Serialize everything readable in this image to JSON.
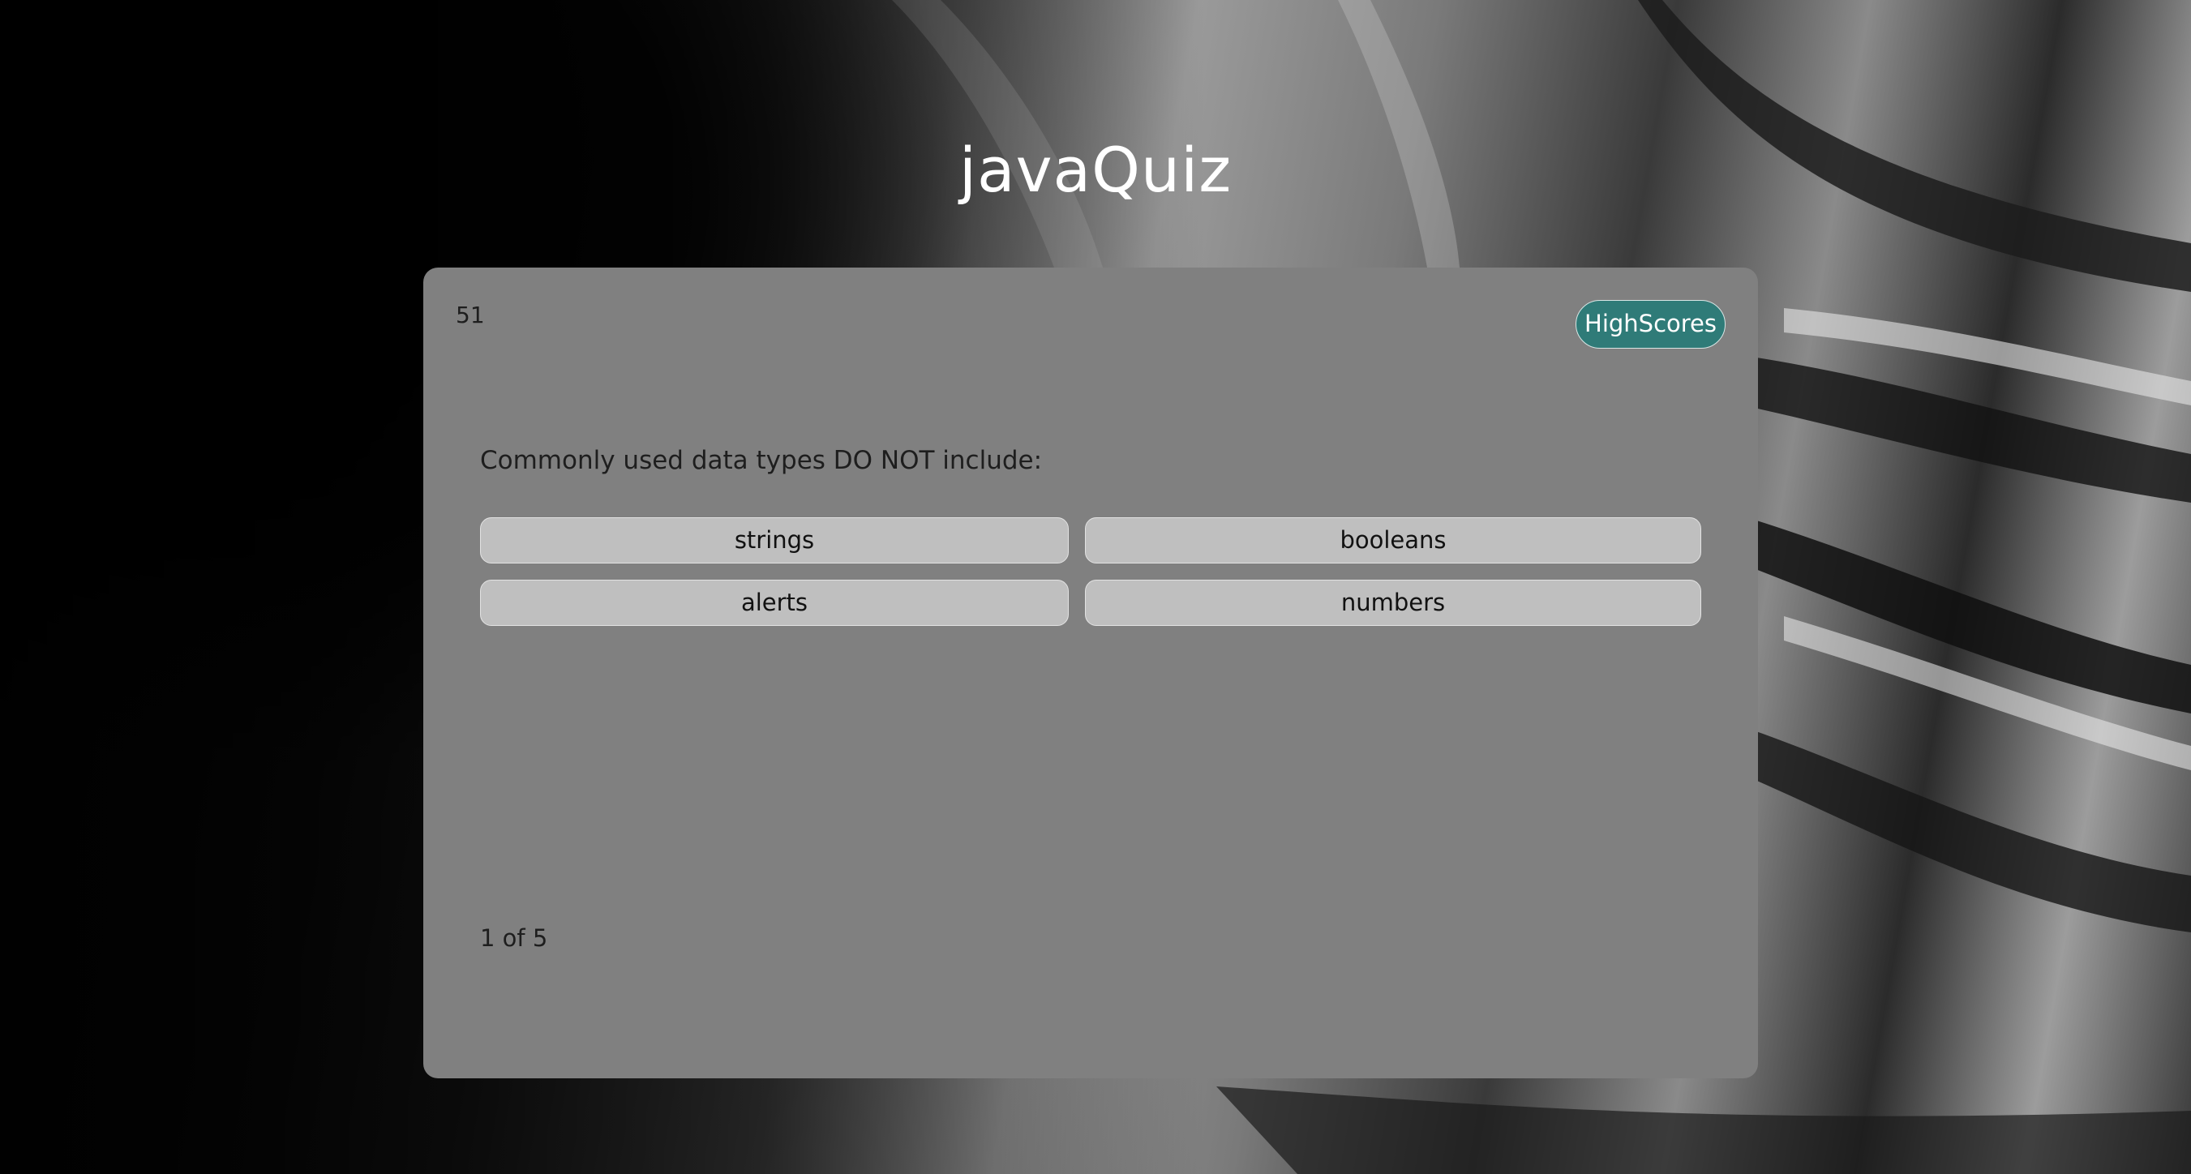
{
  "header": {
    "title": "javaQuiz"
  },
  "quiz": {
    "timer": "51",
    "highscores_label": "HighScores",
    "question": "Commonly used data types DO NOT include:",
    "answers": [
      "strings",
      "booleans",
      "alerts",
      "numbers"
    ],
    "progress": "1 of 5"
  },
  "colors": {
    "card_background": "#808080",
    "highscores_button": "#2f7b78",
    "answer_button": "#bfbfbf",
    "title_text": "#ffffff"
  }
}
